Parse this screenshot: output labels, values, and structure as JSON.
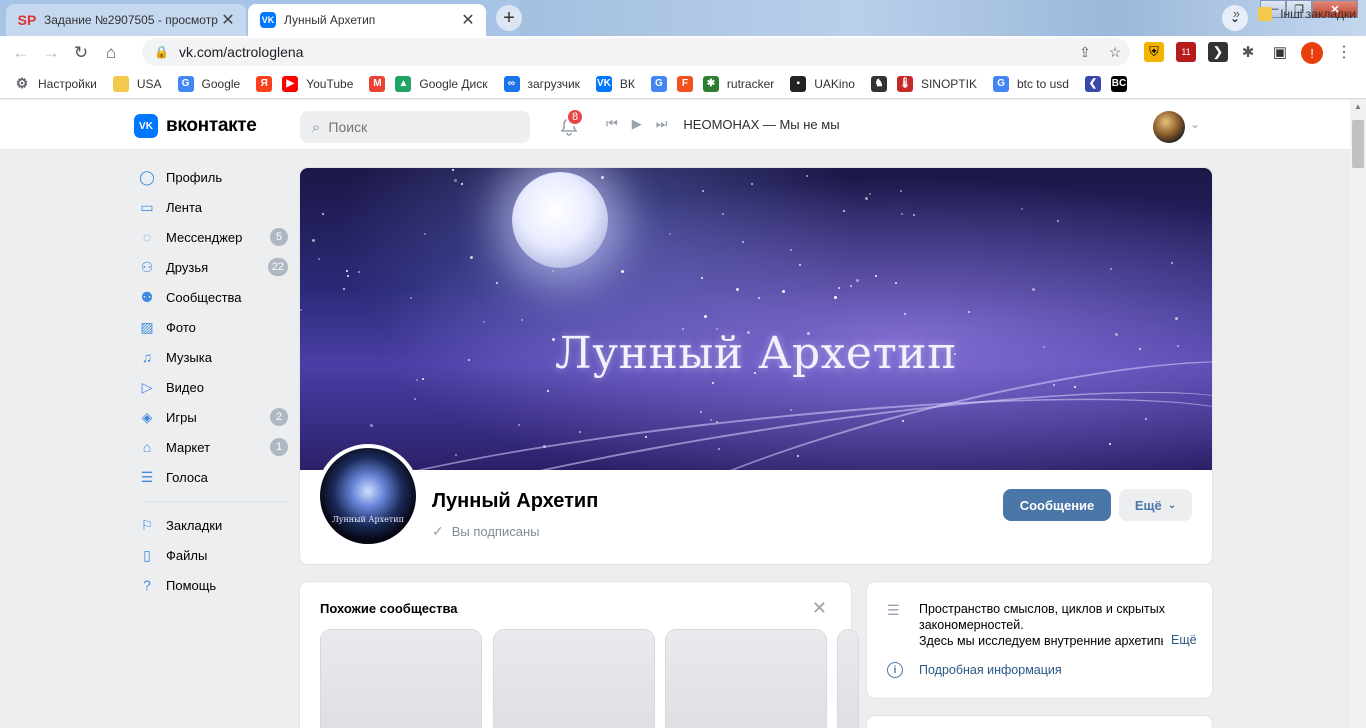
{
  "browser": {
    "tabs": [
      {
        "favicon": "SP",
        "title": "Задание №2907505 - просмотр",
        "active": false
      },
      {
        "favicon": "VK",
        "title": "Лунный Архетип",
        "active": true
      }
    ],
    "url": "vk.com/actrologlena",
    "bookmarks": [
      {
        "label": "Настройки",
        "icon": "gear-icon",
        "color": "#5f6368"
      },
      {
        "label": "USA",
        "icon": "folder-icon",
        "color": "#f2c94c"
      },
      {
        "label": "Google",
        "icon": "google-icon",
        "color": "#4285f4"
      },
      {
        "label": "",
        "icon": "yandex-icon",
        "color": "#fc3f1d"
      },
      {
        "label": "YouTube",
        "icon": "youtube-icon",
        "color": "#ff0000"
      },
      {
        "label": "",
        "icon": "gmail-icon",
        "color": "#ea4335"
      },
      {
        "label": "Google Диск",
        "icon": "drive-icon",
        "color": "#1fa463"
      },
      {
        "label": "загрузчик",
        "icon": "loop-icon",
        "color": "#1a73e8"
      },
      {
        "label": "ВК",
        "icon": "vk-icon",
        "color": "#0077ff"
      },
      {
        "label": "",
        "icon": "translate-icon",
        "color": "#4285f4"
      },
      {
        "label": "",
        "icon": "f-icon",
        "color": "#f4511e"
      },
      {
        "label": "rutracker",
        "icon": "rutracker-icon",
        "color": "#2e7d32"
      },
      {
        "label": "UAKino",
        "icon": "uakino-icon",
        "color": "#222222"
      },
      {
        "label": "",
        "icon": "chess-icon",
        "color": "#333333"
      },
      {
        "label": "SINOPTIK",
        "icon": "thermometer-icon",
        "color": "#c62828"
      },
      {
        "label": "btc to usd",
        "icon": "google-icon",
        "color": "#4285f4"
      },
      {
        "label": "",
        "icon": "arrow-icon",
        "color": "#3949ab"
      },
      {
        "label": "",
        "icon": "bc-icon",
        "color": "#000000"
      }
    ],
    "other_bookmarks": "Інші закладки",
    "ext_badge": "11",
    "profile_letter": "!"
  },
  "vk": {
    "logo_text": "вконтакте",
    "search_placeholder": "Поиск",
    "notifications_count": "8",
    "now_playing": "НЕОМОНАХ — Мы не мы",
    "nav": [
      {
        "label": "Профиль",
        "icon": "profile-icon",
        "count": ""
      },
      {
        "label": "Лента",
        "icon": "feed-icon",
        "count": ""
      },
      {
        "label": "Мессенджер",
        "icon": "messenger-icon",
        "count": "5"
      },
      {
        "label": "Друзья",
        "icon": "friends-icon",
        "count": "22"
      },
      {
        "label": "Сообщества",
        "icon": "communities-icon",
        "count": ""
      },
      {
        "label": "Фото",
        "icon": "photo-icon",
        "count": ""
      },
      {
        "label": "Музыка",
        "icon": "music-icon",
        "count": ""
      },
      {
        "label": "Видео",
        "icon": "video-icon",
        "count": ""
      },
      {
        "label": "Игры",
        "icon": "games-icon",
        "count": "2"
      },
      {
        "label": "Маркет",
        "icon": "market-icon",
        "count": "1"
      },
      {
        "label": "Голоса",
        "icon": "votes-icon",
        "count": ""
      }
    ],
    "nav_secondary": [
      {
        "label": "Закладки",
        "icon": "bookmark-icon"
      },
      {
        "label": "Файлы",
        "icon": "file-icon"
      },
      {
        "label": "Помощь",
        "icon": "help-icon"
      }
    ]
  },
  "group": {
    "cover_title": "Лунный Архетип",
    "avatar_label": "Лунный Архетип",
    "name": "Лунный Архетип",
    "subscribed_text": "Вы подписаны",
    "message_button": "Сообщение",
    "more_button": "Ещё",
    "similar_title": "Похожие сообщества",
    "description_line1": "Пространство смыслов, циклов и скрытых закономерностей.",
    "description_line2": "Здесь мы исследуем внутренние архетипы",
    "description_more": "Ещё",
    "details_link": "Подробная информация"
  },
  "colors": {
    "vk_blue": "#0077ff",
    "button_blue": "#4a76a8",
    "link_blue": "#2a5885",
    "badge_red": "#e64646"
  }
}
